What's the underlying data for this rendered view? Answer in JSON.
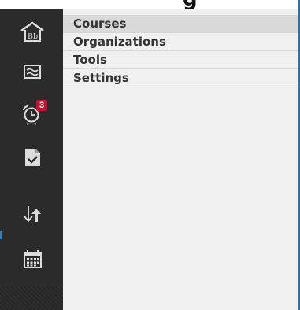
{
  "header": {
    "partial_text": "g"
  },
  "sidebar": {
    "icons": [
      {
        "name": "home-icon",
        "label": "Bb"
      },
      {
        "name": "activity-stream-icon"
      },
      {
        "name": "alarm-clock-icon",
        "badge": "3"
      },
      {
        "name": "grades-icon"
      },
      {
        "name": "sort-arrows-icon"
      },
      {
        "name": "calendar-icon"
      }
    ]
  },
  "menu": {
    "items": [
      {
        "label": "Courses",
        "selected": true
      },
      {
        "label": "Organizations"
      },
      {
        "label": "Tools"
      },
      {
        "label": "Settings"
      }
    ]
  },
  "colors": {
    "sidebar_bg": "#2b2b2b",
    "menu_bg": "#f0f0f0",
    "selected_bg": "#d9d9d9",
    "badge_red": "#c8102e",
    "accent_blue": "#1f74b8"
  }
}
